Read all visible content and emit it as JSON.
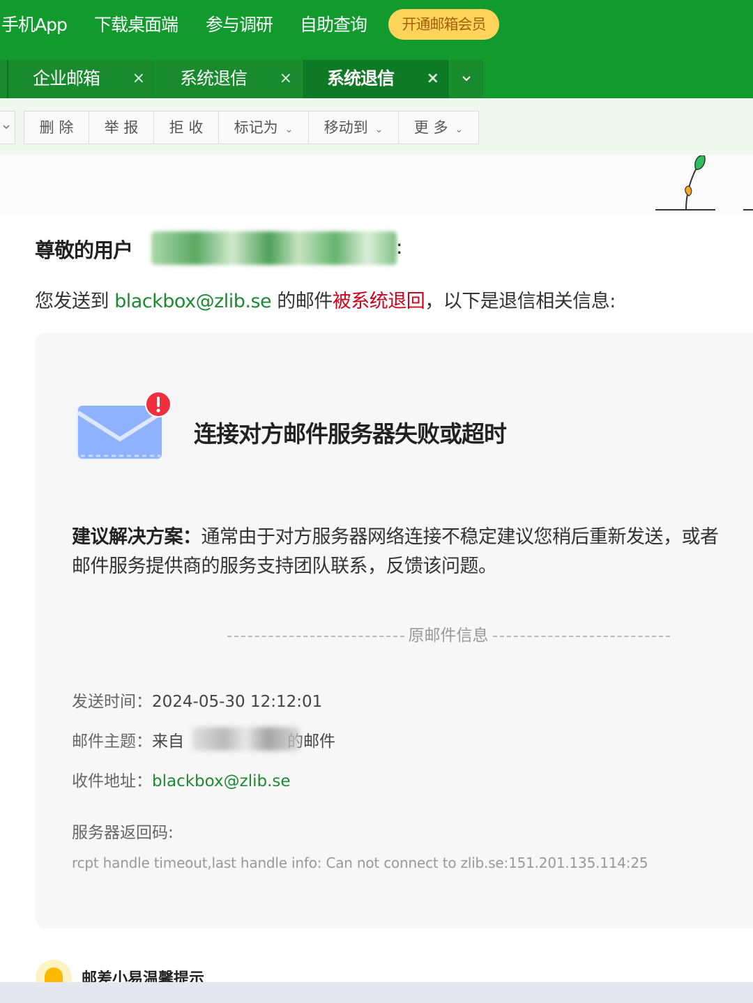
{
  "top_nav": {
    "items": [
      "手机App",
      "下载桌面端",
      "参与调研",
      "自助查询"
    ],
    "vip_button": "开通邮箱会员"
  },
  "tabs": [
    {
      "label": "企业邮箱",
      "close": "×",
      "active": false
    },
    {
      "label": "系统退信",
      "close": "×",
      "active": false
    },
    {
      "label": "系统退信",
      "close": "×",
      "active": true
    }
  ],
  "tab_more_icon": "chevron-down-icon",
  "toolbar": {
    "buttons": [
      {
        "label": "删 除",
        "caret": ""
      },
      {
        "label": "举 报",
        "caret": ""
      },
      {
        "label": "拒 收",
        "caret": ""
      },
      {
        "label": "标记为",
        "caret": "⌄"
      },
      {
        "label": "移动到",
        "caret": "⌄"
      },
      {
        "label": "更 多",
        "caret": "⌄"
      }
    ]
  },
  "mail": {
    "greeting": "尊敬的用户",
    "greeting_colon": ":",
    "intro_prefix": "您发送到 ",
    "intro_email": "blackbox@zlib.se",
    "intro_middle": " 的邮件",
    "intro_highlight": "被系统退回",
    "intro_suffix": "，以下是退信相关信息:",
    "fail_title": "连接对方邮件服务器失败或超时",
    "suggest_label": "建议解决方案：",
    "suggest_line1": "通常由于对方服务器网络连接不稳定建议您稍后重新发送，或者",
    "suggest_line2": "邮件服务提供商的服务支持团队联系，反馈该问题。",
    "divider_text": "原邮件信息",
    "send_time_label": "发送时间：",
    "send_time_value": "2024-05-30 12:12:01",
    "subject_label": "邮件主题：",
    "subject_prefix": "来自",
    "subject_suffix": "的邮件",
    "recipient_label": "收件地址：",
    "recipient_value": "blackbox@zlib.se",
    "return_code_label": "服务器返回码:",
    "return_code_value": "rcpt handle timeout,last handle info: Can not connect to zlib.se:151.201.135.114:25"
  },
  "tip": {
    "title": "邮差小易温馨提示"
  },
  "colors": {
    "brand_green": "#139a2f",
    "vip_yellow": "#ffd45a",
    "link_green": "#1c8a33",
    "alert_red": "#d0021b"
  }
}
